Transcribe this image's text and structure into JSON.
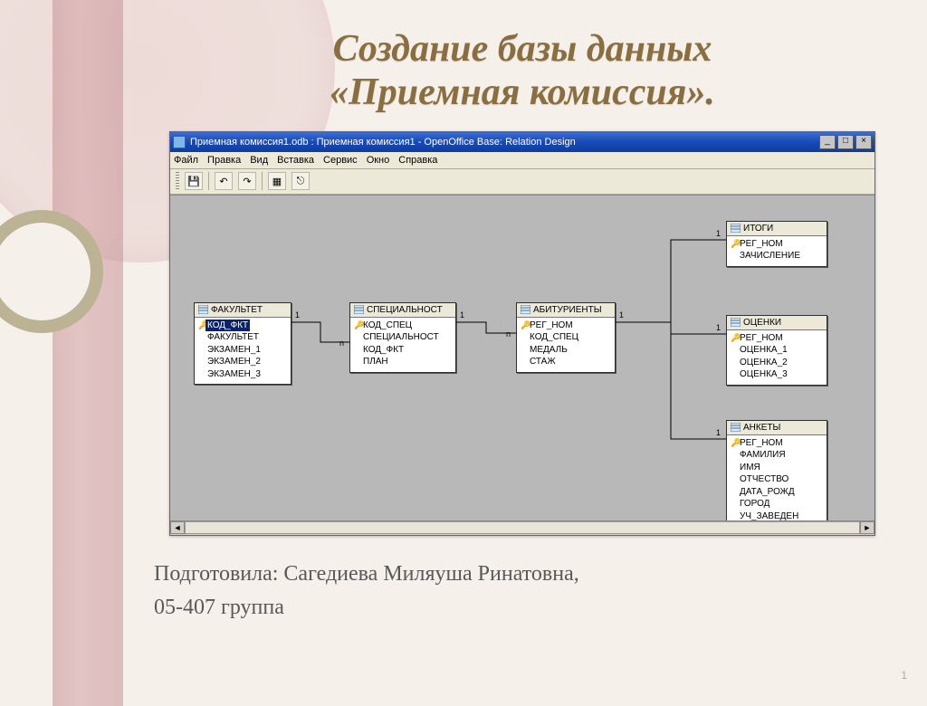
{
  "slide": {
    "title_line1": "Создание базы данных",
    "title_line2": "«Приемная комиссия».",
    "author_line": "Подготовила: Сагедиева Миляуша Ринатовна,",
    "group_line": "05-407 группа",
    "page_number": "1"
  },
  "window": {
    "title": "Приемная комиссия1.odb : Приемная комиссия1 - OpenOffice Base: Relation Design",
    "menu": [
      "Файл",
      "Правка",
      "Вид",
      "Вставка",
      "Сервис",
      "Окно",
      "Справка"
    ]
  },
  "tables": {
    "t1": {
      "name": "ФАКУЛЬТЕТ",
      "fields": [
        "КОД_ФКТ",
        "ФАКУЛЬТЕТ",
        "ЭКЗАМЕН_1",
        "ЭКЗАМЕН_2",
        "ЭКЗАМЕН_3"
      ],
      "key_index": 0,
      "selected_index": 0
    },
    "t2": {
      "name": "СПЕЦИАЛЬНОСТ",
      "fields": [
        "КОД_СПЕЦ",
        "СПЕЦИАЛЬНОСТ",
        "КОД_ФКТ",
        "ПЛАН"
      ],
      "key_index": 0
    },
    "t3": {
      "name": "АБИТУРИЕНТЫ",
      "fields": [
        "РЕГ_НОМ",
        "КОД_СПЕЦ",
        "МЕДАЛЬ",
        "СТАЖ"
      ],
      "key_index": 0
    },
    "t4": {
      "name": "ИТОГИ",
      "fields": [
        "РЕГ_НОМ",
        "ЗАЧИСЛЕНИЕ"
      ],
      "key_index": 0
    },
    "t5": {
      "name": "ОЦЕНКИ",
      "fields": [
        "РЕГ_НОМ",
        "ОЦЕНКА_1",
        "ОЦЕНКА_2",
        "ОЦЕНКА_3"
      ],
      "key_index": 0
    },
    "t6": {
      "name": "АНКЕТЫ",
      "fields": [
        "РЕГ_НОМ",
        "ФАМИЛИЯ",
        "ИМЯ",
        "ОТЧЕСТВО",
        "ДАТА_РОЖД",
        "ГОРОД",
        "УЧ_ЗАВЕДЕН"
      ],
      "key_index": 0
    }
  },
  "relations": {
    "one": "1",
    "many": "n"
  }
}
